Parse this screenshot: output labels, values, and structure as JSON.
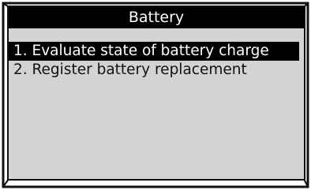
{
  "screen": {
    "title": "Battery",
    "menu_items": [
      {
        "label": "1. Evaluate state of battery charge",
        "selected": true
      },
      {
        "label": "2. Register battery replacement",
        "selected": false
      }
    ]
  },
  "colors": {
    "screen_background": "#d3d3d3",
    "title_background": "#000000",
    "title_text": "#ffffff",
    "highlight_background": "#000000",
    "highlight_text": "#ffffff",
    "bezel": "#111111"
  }
}
